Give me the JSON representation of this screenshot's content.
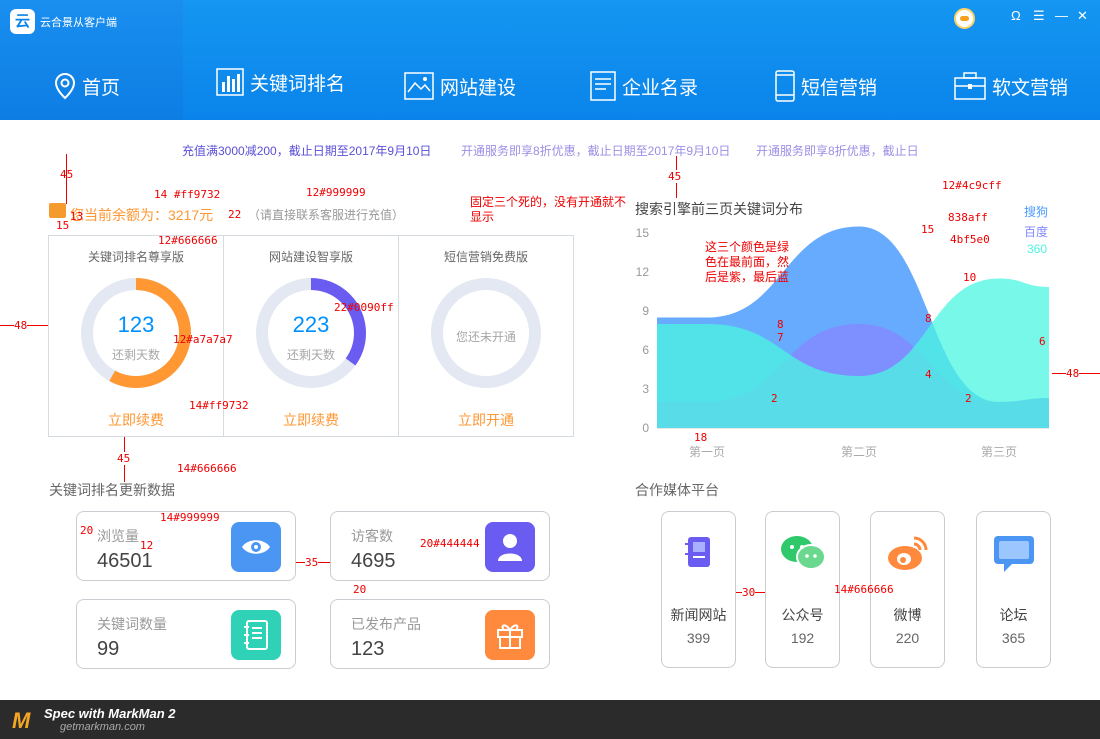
{
  "app": {
    "title": "云合景从客户端",
    "logo_text": "云"
  },
  "nav": [
    {
      "label": "首页",
      "icon": "location-pin-icon"
    },
    {
      "label": "关键词排名",
      "icon": "bar-chart-icon"
    },
    {
      "label": "网站建设",
      "icon": "website-icon"
    },
    {
      "label": "企业名录",
      "icon": "book-icon"
    },
    {
      "label": "短信营销",
      "icon": "phone-icon"
    },
    {
      "label": "软文营销",
      "icon": "briefcase-icon"
    }
  ],
  "window_controls": {
    "headset": "Ω",
    "menu": "☰",
    "minimize": "—",
    "close": "✕"
  },
  "promos": [
    {
      "text": "充值满3000减200，截止日期至2017年9月10日",
      "color": "#5b4fd8"
    },
    {
      "text": "开通服务即享8折优惠，截止日期至2017年9月10日",
      "color": "#9b8fe6"
    },
    {
      "text": "开通服务即享8折优惠，截止日",
      "color": "#9b8fe6"
    }
  ],
  "balance": {
    "text": "您当前余额为：3217元",
    "tip": "（请直接联系客服进行充值）"
  },
  "packages": [
    {
      "title": "关键词排名尊享版",
      "value": "123",
      "sub": "还剩天数",
      "link": "立即续费",
      "progress": 0.58,
      "color": "#ff9732",
      "num_color": "#0090ff"
    },
    {
      "title": "网站建设智享版",
      "value": "223",
      "sub": "还剩天数",
      "link": "立即续费",
      "progress": 0.35,
      "color": "#6a5cf0",
      "num_color": "#0090ff"
    },
    {
      "title": "短信营销免费版",
      "value": "",
      "sub": "",
      "none_text": "您还未开通",
      "link": "立即开通",
      "progress": 0
    }
  ],
  "chart_title": "搜索引擎前三页关键词分布",
  "chart_data": {
    "type": "area",
    "categories": [
      "第一页",
      "第二页",
      "第三页"
    ],
    "yticks": [
      0,
      3,
      6,
      9,
      12,
      15
    ],
    "ylim": [
      0,
      16
    ],
    "series": [
      {
        "name": "搜狗",
        "color": "#4c9cff",
        "values": [
          8.5,
          15.5,
          2
        ]
      },
      {
        "name": "百度",
        "color": "#838aff",
        "values": [
          2,
          8,
          2
        ]
      },
      {
        "name": "360",
        "color": "#4bf5e0",
        "values": [
          8,
          4,
          11.5
        ]
      }
    ],
    "point_labels": [
      "8",
      "7",
      "2",
      "15",
      "8",
      "4",
      "10",
      "6",
      "2"
    ]
  },
  "stats_title": "关键词排名更新数据",
  "stats": [
    {
      "label": "浏览量",
      "value": "46501",
      "icon": "eye-icon",
      "bg": "#4a96f2"
    },
    {
      "label": "访客数",
      "value": "4695",
      "icon": "user-icon",
      "bg": "#6a5cf0"
    },
    {
      "label": "关键词数量",
      "value": "99",
      "icon": "notebook-icon",
      "bg": "#2fd1b7"
    },
    {
      "label": "已发布产品",
      "value": "123",
      "icon": "gift-icon",
      "bg": "#ff8a3d"
    }
  ],
  "media_title": "合作媒体平台",
  "media": [
    {
      "name": "新闻网站",
      "count": "399",
      "icon": "news-icon"
    },
    {
      "name": "公众号",
      "count": "192",
      "icon": "wechat-icon"
    },
    {
      "name": "微博",
      "count": "220",
      "icon": "weibo-icon"
    },
    {
      "name": "论坛",
      "count": "365",
      "icon": "forum-icon"
    }
  ],
  "annotations": {
    "a45_1": "45",
    "a13": "13",
    "a15": "15",
    "a14ff": "14 #ff9732",
    "a22": "22",
    "a12_999": "12#999999",
    "a12_666": "12#666666",
    "a48_l": "48",
    "a22_0090": "22#0090ff",
    "a12_a7": "12#a7a7a7",
    "a14_ff": "14#ff9732",
    "a45_2": "45",
    "a14_666": "14#666666",
    "note_fixed": "固定三个死的，没有开通就不显示",
    "a45_3": "45",
    "note_colors": "这三个颜色是绿色在最前面，然后是紫，最后蓝",
    "a12_4c": "12#4c9cff",
    "a838": "838aff",
    "a4bf": "4bf5e0",
    "a48_r": "48",
    "a18": "18",
    "a20": "20",
    "a14_999": "14#999999",
    "a12": "12",
    "a35": "35",
    "a20_444": "20#444444",
    "a20b": "20",
    "a30": "30",
    "a14_666b": "14#666666"
  },
  "footer": {
    "title": "Spec with MarkMan 2",
    "site": "getmarkman.com",
    "logo": "M"
  }
}
